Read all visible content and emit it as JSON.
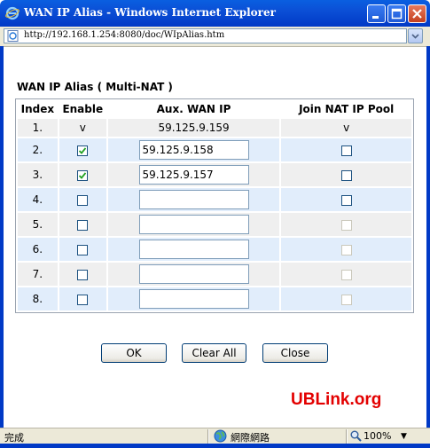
{
  "window": {
    "title": "WAN IP Alias - Windows Internet Explorer",
    "address": "http://192.168.1.254:8080/doc/WIpAlias.htm",
    "colors": {
      "titlebar": "#0b4fd6",
      "close_button": "#c4401f"
    }
  },
  "page": {
    "section_title": "WAN IP Alias ( Multi-NAT )",
    "headers": {
      "index": "Index",
      "enable": "Enable",
      "aux_wan_ip": "Aux. WAN IP",
      "join_nat": "Join NAT IP Pool"
    },
    "first_row": {
      "index": "1.",
      "enable": "v",
      "ip": "59.125.9.159",
      "join": "v"
    },
    "rows": [
      {
        "index": "2.",
        "enable": true,
        "ip": "59.125.9.158",
        "join": false,
        "join_enabled": true
      },
      {
        "index": "3.",
        "enable": true,
        "ip": "59.125.9.157",
        "join": false,
        "join_enabled": true
      },
      {
        "index": "4.",
        "enable": false,
        "ip": "",
        "join": false,
        "join_enabled": true
      },
      {
        "index": "5.",
        "enable": false,
        "ip": "",
        "join": false,
        "join_enabled": false
      },
      {
        "index": "6.",
        "enable": false,
        "ip": "",
        "join": false,
        "join_enabled": false
      },
      {
        "index": "7.",
        "enable": false,
        "ip": "",
        "join": false,
        "join_enabled": false
      },
      {
        "index": "8.",
        "enable": false,
        "ip": "",
        "join": false,
        "join_enabled": false
      }
    ],
    "buttons": {
      "ok": "OK",
      "clear_all": "Clear All",
      "close": "Close"
    },
    "watermark": "UBLink.org"
  },
  "status": {
    "text": "完成",
    "zone": "網際網路",
    "zoom": "100%"
  },
  "icons": {
    "ie": "ie-icon",
    "minimize": "minimize-icon",
    "maximize": "maximize-icon",
    "close": "close-icon",
    "globe": "globe-icon",
    "zoom": "magnifier-icon"
  }
}
